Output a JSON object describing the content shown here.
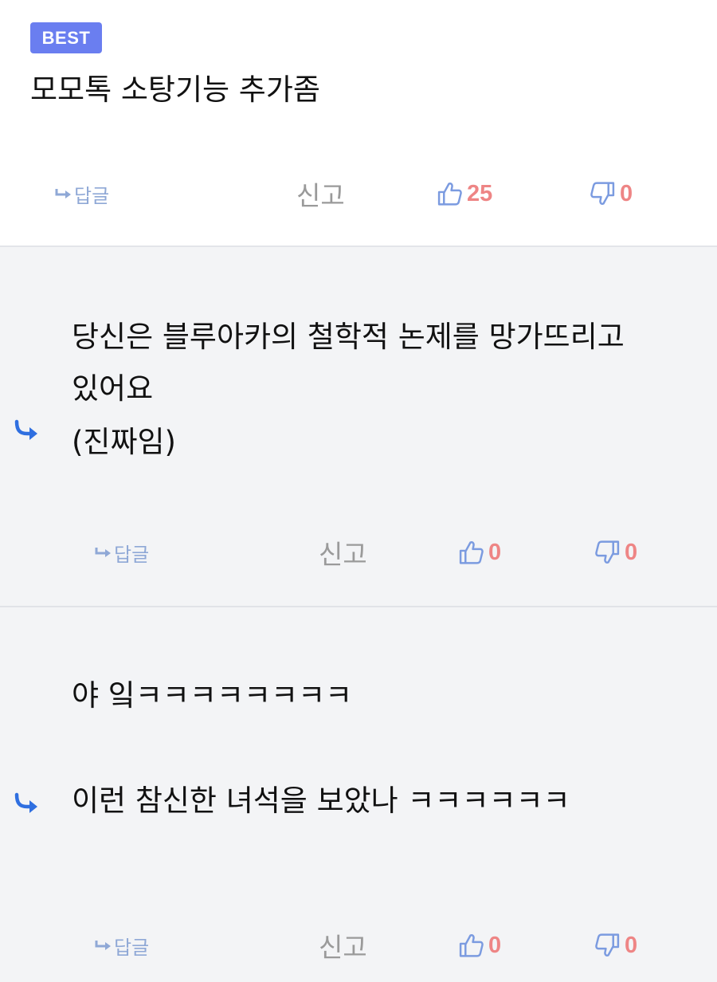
{
  "best_comment": {
    "badge": "BEST",
    "text": "모모톡 소탕기능 추가좀",
    "actions": {
      "reply": "답글",
      "report": "신고",
      "likes": "25",
      "dislikes": "0"
    }
  },
  "replies": [
    {
      "lines": [
        "당신은 블루아카의 철학적 논제를 망가뜨리고",
        "있어요",
        "(진짜임)"
      ],
      "actions": {
        "reply": "답글",
        "report": "신고",
        "likes": "0",
        "dislikes": "0"
      }
    },
    {
      "lines": [
        "야 잌ㅋㅋㅋㅋㅋㅋㅋㅋ",
        "이런 참신한 녀석을 보았나 ㅋㅋㅋㅋㅋㅋ"
      ],
      "actions": {
        "reply": "답글",
        "report": "신고",
        "likes": "0",
        "dislikes": "0"
      }
    }
  ],
  "colors": {
    "badge": "#6a7ef0",
    "reply_link": "#8fa8d6",
    "report": "#9a9a9a",
    "vote_count": "#ee8585",
    "thumb_icon": "#7b9be0",
    "reply_arrow": "#2f6fe0",
    "reply_background": "#f3f4f6"
  },
  "icons": {
    "reply_marker": "reply-arrow-icon",
    "reply_link": "small-reply-arrow-icon",
    "like": "thumbs-up-icon",
    "dislike": "thumbs-down-icon"
  }
}
